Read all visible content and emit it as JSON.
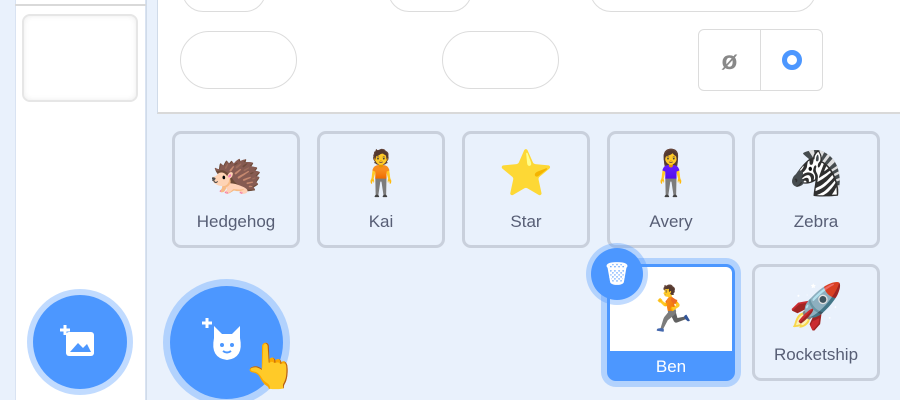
{
  "sprites": [
    {
      "name": "Hedgehog",
      "icon": "hedgehog"
    },
    {
      "name": "Kai",
      "icon": "kai"
    },
    {
      "name": "Star",
      "icon": "star"
    },
    {
      "name": "Avery",
      "icon": "avery"
    },
    {
      "name": "Zebra",
      "icon": "zebra"
    },
    {
      "name": "Ben",
      "icon": "ben",
      "selected": true
    },
    {
      "name": "Rocketship",
      "icon": "rocketship"
    }
  ],
  "colors": {
    "accent": "#4c97ff",
    "background": "#e9f1fc",
    "tile_border": "#c9d0dc"
  }
}
